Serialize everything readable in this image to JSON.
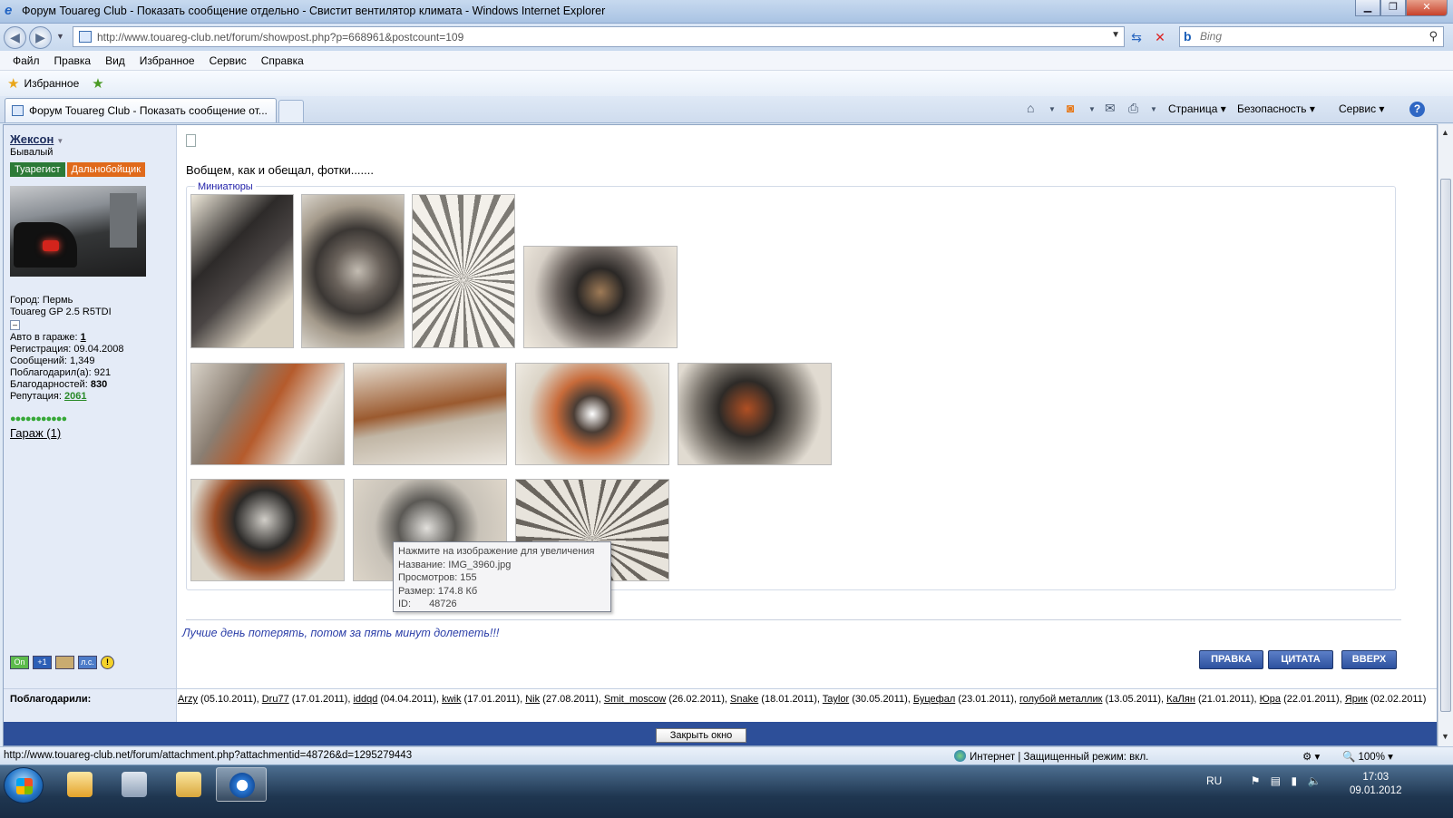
{
  "window": {
    "title": "Форум Touareg Club - Показать сообщение отдельно - Свистит вентилятор климата - Windows Internet Explorer"
  },
  "address": {
    "url": "http://www.touareg-club.net/forum/showpost.php?p=668961&postcount=109",
    "search_placeholder": "Bing"
  },
  "menu": [
    "Файл",
    "Правка",
    "Вид",
    "Избранное",
    "Сервис",
    "Справка"
  ],
  "favorites": {
    "label": "Избранное"
  },
  "tab": {
    "title": "Форум Touareg Club - Показать сообщение от..."
  },
  "commands": {
    "page": "Страница",
    "safety": "Безопасность",
    "tools": "Сервис"
  },
  "user": {
    "name": "Жексон",
    "title": "Бывалый",
    "badges": [
      "Туарегист",
      "Дальнобойщик"
    ],
    "city": "Город: Пермь",
    "car": "Touareg GP 2.5 R5TDI",
    "garage_autos_label": "Авто в гараже:",
    "garage_autos_value": "1",
    "registered": "Регистрация: 09.04.2008",
    "messages": "Сообщений: 1,349",
    "thanked_label": "Поблагодарил(а): 921",
    "thanks_label": "Благодарностей:",
    "thanks_value": "830",
    "reputation_label": "Репутация:",
    "reputation_value": "2061",
    "garage_link": "Гараж (1)",
    "status_icons": [
      "On",
      "+1",
      "",
      "л.с."
    ]
  },
  "post": {
    "text": "Вобщем, как и обещал, фотки.......",
    "attachments_legend": "Миниатюры",
    "tooltip": {
      "hint": "Нажмите на изображение для увеличения",
      "name": "Название: IMG_3960.jpg",
      "views": "Просмотров: 155",
      "size": "Размер: 174.8 Кб",
      "id_label": "ID:",
      "id_value": "48726"
    },
    "signature": "Лучше день потерять, потом за пять минут долететь!!!",
    "buttons": {
      "edit": "ПРАВКА",
      "quote": "ЦИТАТА",
      "top": "ВВЕРХ"
    }
  },
  "thanks": {
    "label": "Поблагодарили:",
    "entries": [
      {
        "name": "Arzy",
        "date": "(05.10.2011),"
      },
      {
        "name": "Dru77",
        "date": "(17.01.2011),"
      },
      {
        "name": "iddqd",
        "date": "(04.04.2011),"
      },
      {
        "name": "kwik",
        "date": "(17.01.2011),"
      },
      {
        "name": "Nik",
        "date": "(27.08.2011),"
      },
      {
        "name": "Smit_moscow",
        "date": "(26.02.2011),"
      },
      {
        "name": "Snake",
        "date": "(18.01.2011),"
      },
      {
        "name": "Taylor",
        "date": "(30.05.2011),"
      },
      {
        "name": "Буцефал",
        "date": "(23.01.2011),"
      },
      {
        "name": "голубой металлик",
        "date": "(13.05.2011),"
      },
      {
        "name": "КаЛян",
        "date": "(21.01.2011),"
      },
      {
        "name": "Юра",
        "date": "(22.01.2011),"
      },
      {
        "name": "Ярик",
        "date": "(02.02.2011)"
      }
    ]
  },
  "footer": {
    "close_window": "Закрыть окно"
  },
  "status": {
    "url": "http://www.touareg-club.net/forum/attachment.php?attachmentid=48726&d=1295279443",
    "zone": "Интернет | Защищенный режим: вкл.",
    "zoom": "100%"
  },
  "taskbar": {
    "language": "RU",
    "time": "17:03",
    "date": "09.01.2012"
  }
}
